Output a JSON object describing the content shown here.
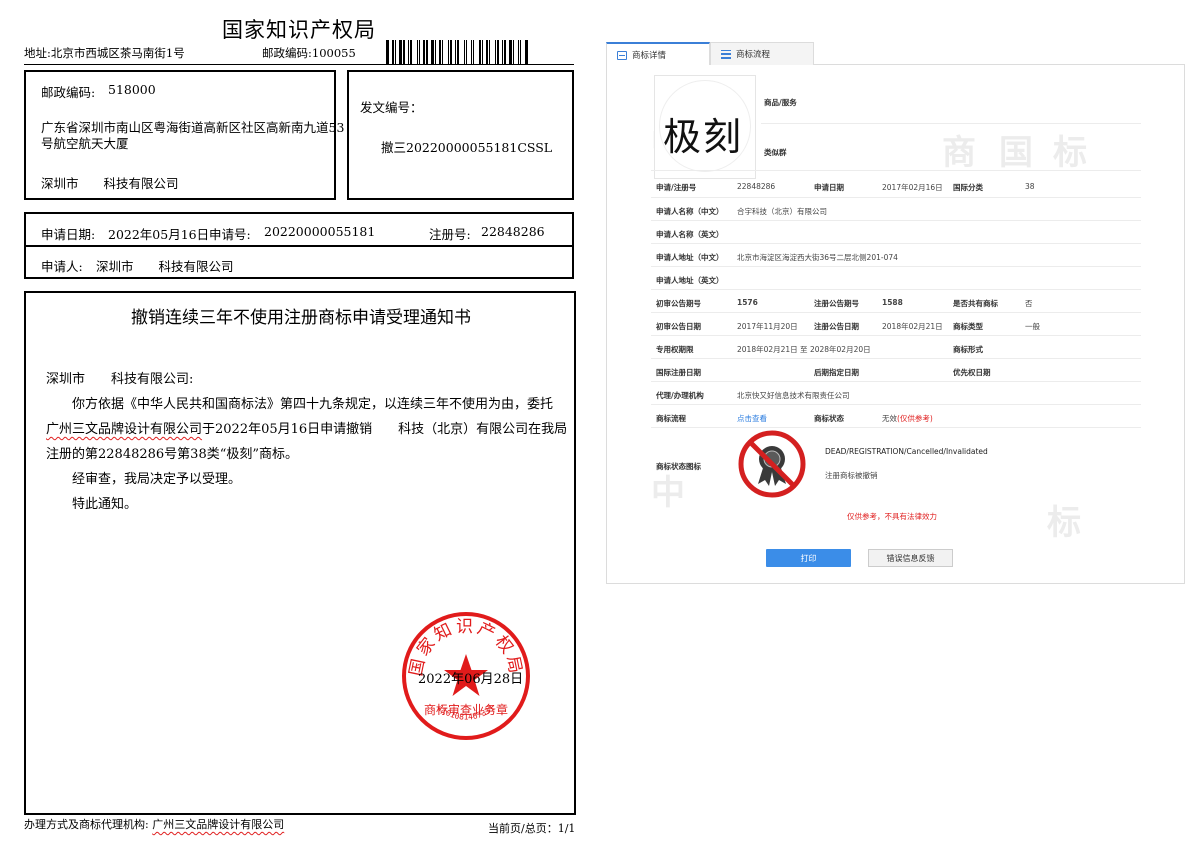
{
  "document": {
    "title": "国家知识产权局",
    "address": "地址:北京市西城区茶马南街1号",
    "top_zip": "邮政编码:100055",
    "recipient": {
      "zip_label": "邮政编码:",
      "zip": "518000",
      "address_line1": "广东省深圳市南山区粤海街道高新区社区高新南九道53",
      "address_line2": "号航空航天大厦",
      "name": "深圳市　　科技有限公司"
    },
    "doc_no_label": "发文编号：",
    "doc_no": "撤三20220000055181CSSL",
    "application": {
      "date_label": "申请日期:",
      "date": "2022年05月16日",
      "app_no_label": "申请号:",
      "app_no": "20220000055181",
      "reg_no_label": "注册号:",
      "reg_no": "22848286",
      "applicant_label": "申请人:",
      "applicant": "深圳市　　科技有限公司"
    },
    "notice": {
      "title": "撤销连续三年不使用注册商标申请受理通知书",
      "salutation": "深圳市　　科技有限公司:",
      "para1_a": "你方依据《中华人民共和国商标法》第四十九条规定，以连续三年不使用为由，委托",
      "para1_agent": "广州三文品牌设计有限公司",
      "para1_b": "于2022年05月16日申请撤销　　科技（北京）有限公司在我局",
      "para1_c": "注册的第22848286号第38类“极刻”商标。",
      "para2": "经审查，我局决定予以受理。",
      "para3": "特此通知。",
      "date": "2022年06月28日"
    },
    "seal": {
      "outer_text": "国家知识产权局",
      "inner_text": "商标审查业务章",
      "number": "1101081467331"
    },
    "footer": {
      "agent_label": "办理方式及商标代理机构:",
      "agent": "广州三文品牌设计有限公司",
      "page": "当前页/总页：1/1"
    }
  },
  "panel": {
    "tabs": [
      "商标详情",
      "商标流程"
    ],
    "watermark": [
      "中",
      "国",
      "商",
      "标"
    ],
    "mark_text": "极刻",
    "goods_label": "商品/服务",
    "similar_label": "类似群",
    "fields": {
      "reg_no_label": "申请/注册号",
      "reg_no": "22848286",
      "app_date_label": "申请日期",
      "app_date": "2017年02月16日",
      "intl_class_label": "国际分类",
      "intl_class": "38",
      "applicant_cn_label": "申请人名称（中文）",
      "applicant_cn": "合宇科技（北京）有限公司",
      "applicant_en_label": "申请人名称（英文）",
      "address_cn_label": "申请人地址（中文）",
      "address_cn": "北京市海淀区海淀西大街36号二层北侧201-074",
      "address_en_label": "申请人地址（英文）",
      "prelim_no_label": "初审公告期号",
      "prelim_no": "1576",
      "reg_pub_no_label": "注册公告期号",
      "reg_pub_no": "1588",
      "shared_label": "是否共有商标",
      "shared": "否",
      "prelim_date_label": "初审公告日期",
      "prelim_date": "2017年11月20日",
      "reg_pub_date_label": "注册公告日期",
      "reg_pub_date": "2018年02月21日",
      "type_label": "商标类型",
      "type": "一般",
      "exclusive_label": "专用权期限",
      "exclusive": "2018年02月21日 至 2028年02月20日",
      "form_label": "商标形式",
      "intl_reg_label": "国际注册日期",
      "later_date_label": "后期指定日期",
      "priority_label": "优先权日期",
      "agent_label": "代理/办理机构",
      "agent": "北京快又好信息技术有限责任公司",
      "flow_label": "商标流程",
      "flow_link": "点击查看",
      "status_label": "商标状态",
      "status": "无效",
      "status_note": "(仅供参考)",
      "status_icon_label": "商标状态图标",
      "status_en": "DEAD/REGISTRATION/Cancelled/Invalidated",
      "status_cn": "注册商标被撤销"
    },
    "disclaimer": "仅供参考，不具有法律效力",
    "buttons": {
      "print": "打印",
      "feedback": "错误信息反馈"
    }
  }
}
